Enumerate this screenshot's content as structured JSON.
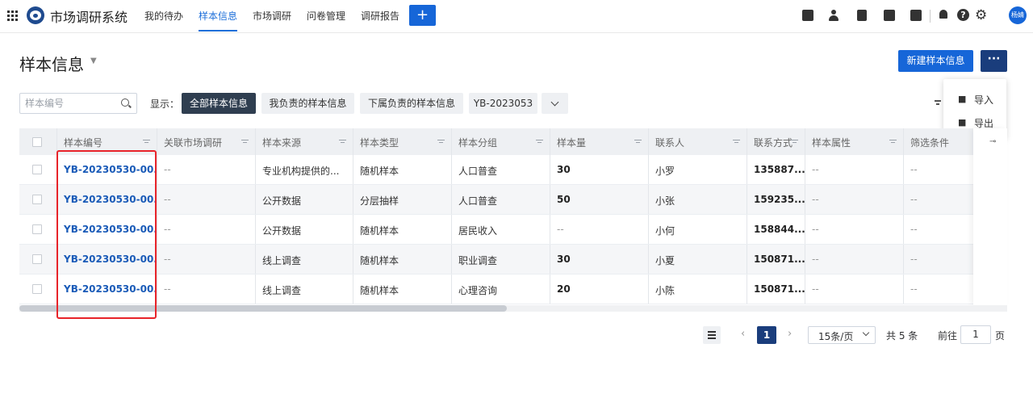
{
  "app": {
    "title": "市场调研系统"
  },
  "nav": {
    "items": [
      "我的待办",
      "样本信息",
      "市场调研",
      "问卷管理",
      "调研报告"
    ],
    "active_index": 1,
    "plus_label": "+"
  },
  "user": {
    "avatar_text": "杨婧"
  },
  "page": {
    "title": "样本信息",
    "new_button": "新建样本信息",
    "more_button": "···",
    "dropdown": [
      "导入",
      "导出"
    ]
  },
  "filter": {
    "search_placeholder": "样本编号",
    "show_label": "显示：",
    "tabs": [
      "全部样本信息",
      "我负责的样本信息",
      "下属负责的样本信息",
      "YB-2023053"
    ],
    "active_index": 0
  },
  "table": {
    "columns": [
      "样本编号",
      "关联市场调研",
      "样本来源",
      "样本类型",
      "样本分组",
      "样本量",
      "联系人",
      "联系方式",
      "样本属性",
      "筛选条件"
    ],
    "rows": [
      [
        "YB-20230530-00...",
        "--",
        "专业机构提供的...",
        "随机样本",
        "人口普查",
        "30",
        "小罗",
        "135887...",
        "--",
        "--"
      ],
      [
        "YB-20230530-00...",
        "--",
        "公开数据",
        "分层抽样",
        "人口普查",
        "50",
        "小张",
        "159235...",
        "--",
        "--"
      ],
      [
        "YB-20230530-00...",
        "--",
        "公开数据",
        "随机样本",
        "居民收入",
        "--",
        "小何",
        "158844...",
        "--",
        "--"
      ],
      [
        "YB-20230530-00...",
        "--",
        "线上调查",
        "随机样本",
        "职业调查",
        "30",
        "小夏",
        "150871...",
        "--",
        "--"
      ],
      [
        "YB-20230530-00...",
        "--",
        "线上调查",
        "随机样本",
        "心理咨询",
        "20",
        "小陈",
        "150871...",
        "--",
        "--"
      ]
    ]
  },
  "pagination": {
    "current_page": "1",
    "page_size": "15条/页",
    "total": "共 5 条",
    "goto_label": "前往",
    "goto_value": "1",
    "goto_unit": "页"
  },
  "colors": {
    "primary": "#1666d8",
    "dark": "#1a3d7c",
    "link": "#1a5bb8",
    "highlight": "#e8242a"
  }
}
